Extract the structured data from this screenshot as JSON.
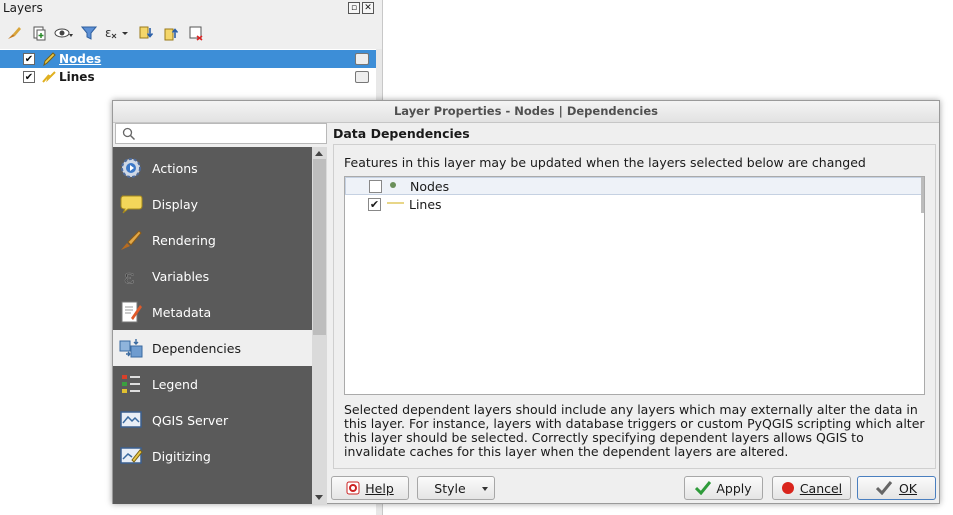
{
  "layers_panel": {
    "title": "Layers",
    "header_buttons": [
      "float-icon",
      "close-icon"
    ],
    "toolbar_icons": [
      "style-brush-icon",
      "add-group-icon",
      "eye-filter-icon",
      "funnel-filter-icon",
      "expression-filter-icon",
      "expand-all-icon",
      "collapse-all-icon",
      "remove-layer-icon"
    ],
    "layers": [
      {
        "name": "Nodes",
        "checked": true,
        "selected": true,
        "icon": "point-layer-pencil-icon"
      },
      {
        "name": "Lines",
        "checked": true,
        "selected": false,
        "icon": "line-layer-icon"
      }
    ]
  },
  "dialog": {
    "title": "Layer Properties - Nodes | Dependencies",
    "search": {
      "placeholder": "",
      "value": ""
    },
    "sidebar": {
      "items": [
        {
          "label": "Actions",
          "icon": "actions-gear-icon",
          "active": false
        },
        {
          "label": "Display",
          "icon": "speech-bubble-icon",
          "active": false
        },
        {
          "label": "Rendering",
          "icon": "paintbrush-icon",
          "active": false
        },
        {
          "label": "Variables",
          "icon": "epsilon-icon",
          "active": false
        },
        {
          "label": "Metadata",
          "icon": "document-pencil-icon",
          "active": false
        },
        {
          "label": "Dependencies",
          "icon": "dependencies-icon",
          "active": true
        },
        {
          "label": "Legend",
          "icon": "legend-icon",
          "active": false
        },
        {
          "label": "QGIS Server",
          "icon": "server-map-icon",
          "active": false
        },
        {
          "label": "Digitizing",
          "icon": "digitizing-icon",
          "active": false
        }
      ]
    },
    "content": {
      "heading": "Data Dependencies",
      "intro": "Features in this layer may be updated when the layers selected below are changed",
      "dependencies": [
        {
          "name": "Nodes",
          "checked": false,
          "icon": "point-dot-icon"
        },
        {
          "name": "Lines",
          "checked": true,
          "icon": "line-dash-icon"
        }
      ],
      "help_text": "Selected dependent layers should include any layers which may externally alter the data in this layer. For instance, layers with database triggers or custom PyQGIS scripting which alter this layer should be selected. Correctly specifying dependent layers allows QGIS to invalidate caches for this layer when the dependent layers are altered."
    },
    "buttons": {
      "help": "Help",
      "style": "Style",
      "apply": "Apply",
      "cancel": "Cancel",
      "ok": "OK"
    },
    "colors": {
      "sidebar_bg": "#5a5a5a",
      "selection_blue": "#3d8ed7",
      "apply_green": "#2e9b3a",
      "cancel_red": "#d9241c"
    }
  }
}
